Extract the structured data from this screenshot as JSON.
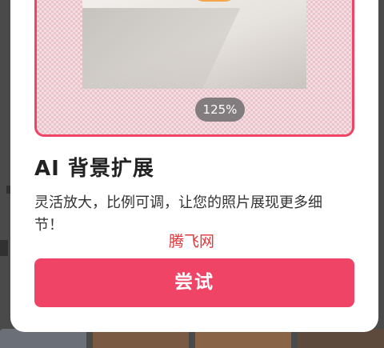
{
  "feature_card": {
    "zoom_level": "125%",
    "title": "AI 背景扩展",
    "description": "灵活放大，比例可调，让您的照片展现更多细节！",
    "try_button_label": "尝试"
  },
  "watermark": "腾飞网",
  "colors": {
    "accent": "#ef4466",
    "watermark": "#e0353a"
  }
}
